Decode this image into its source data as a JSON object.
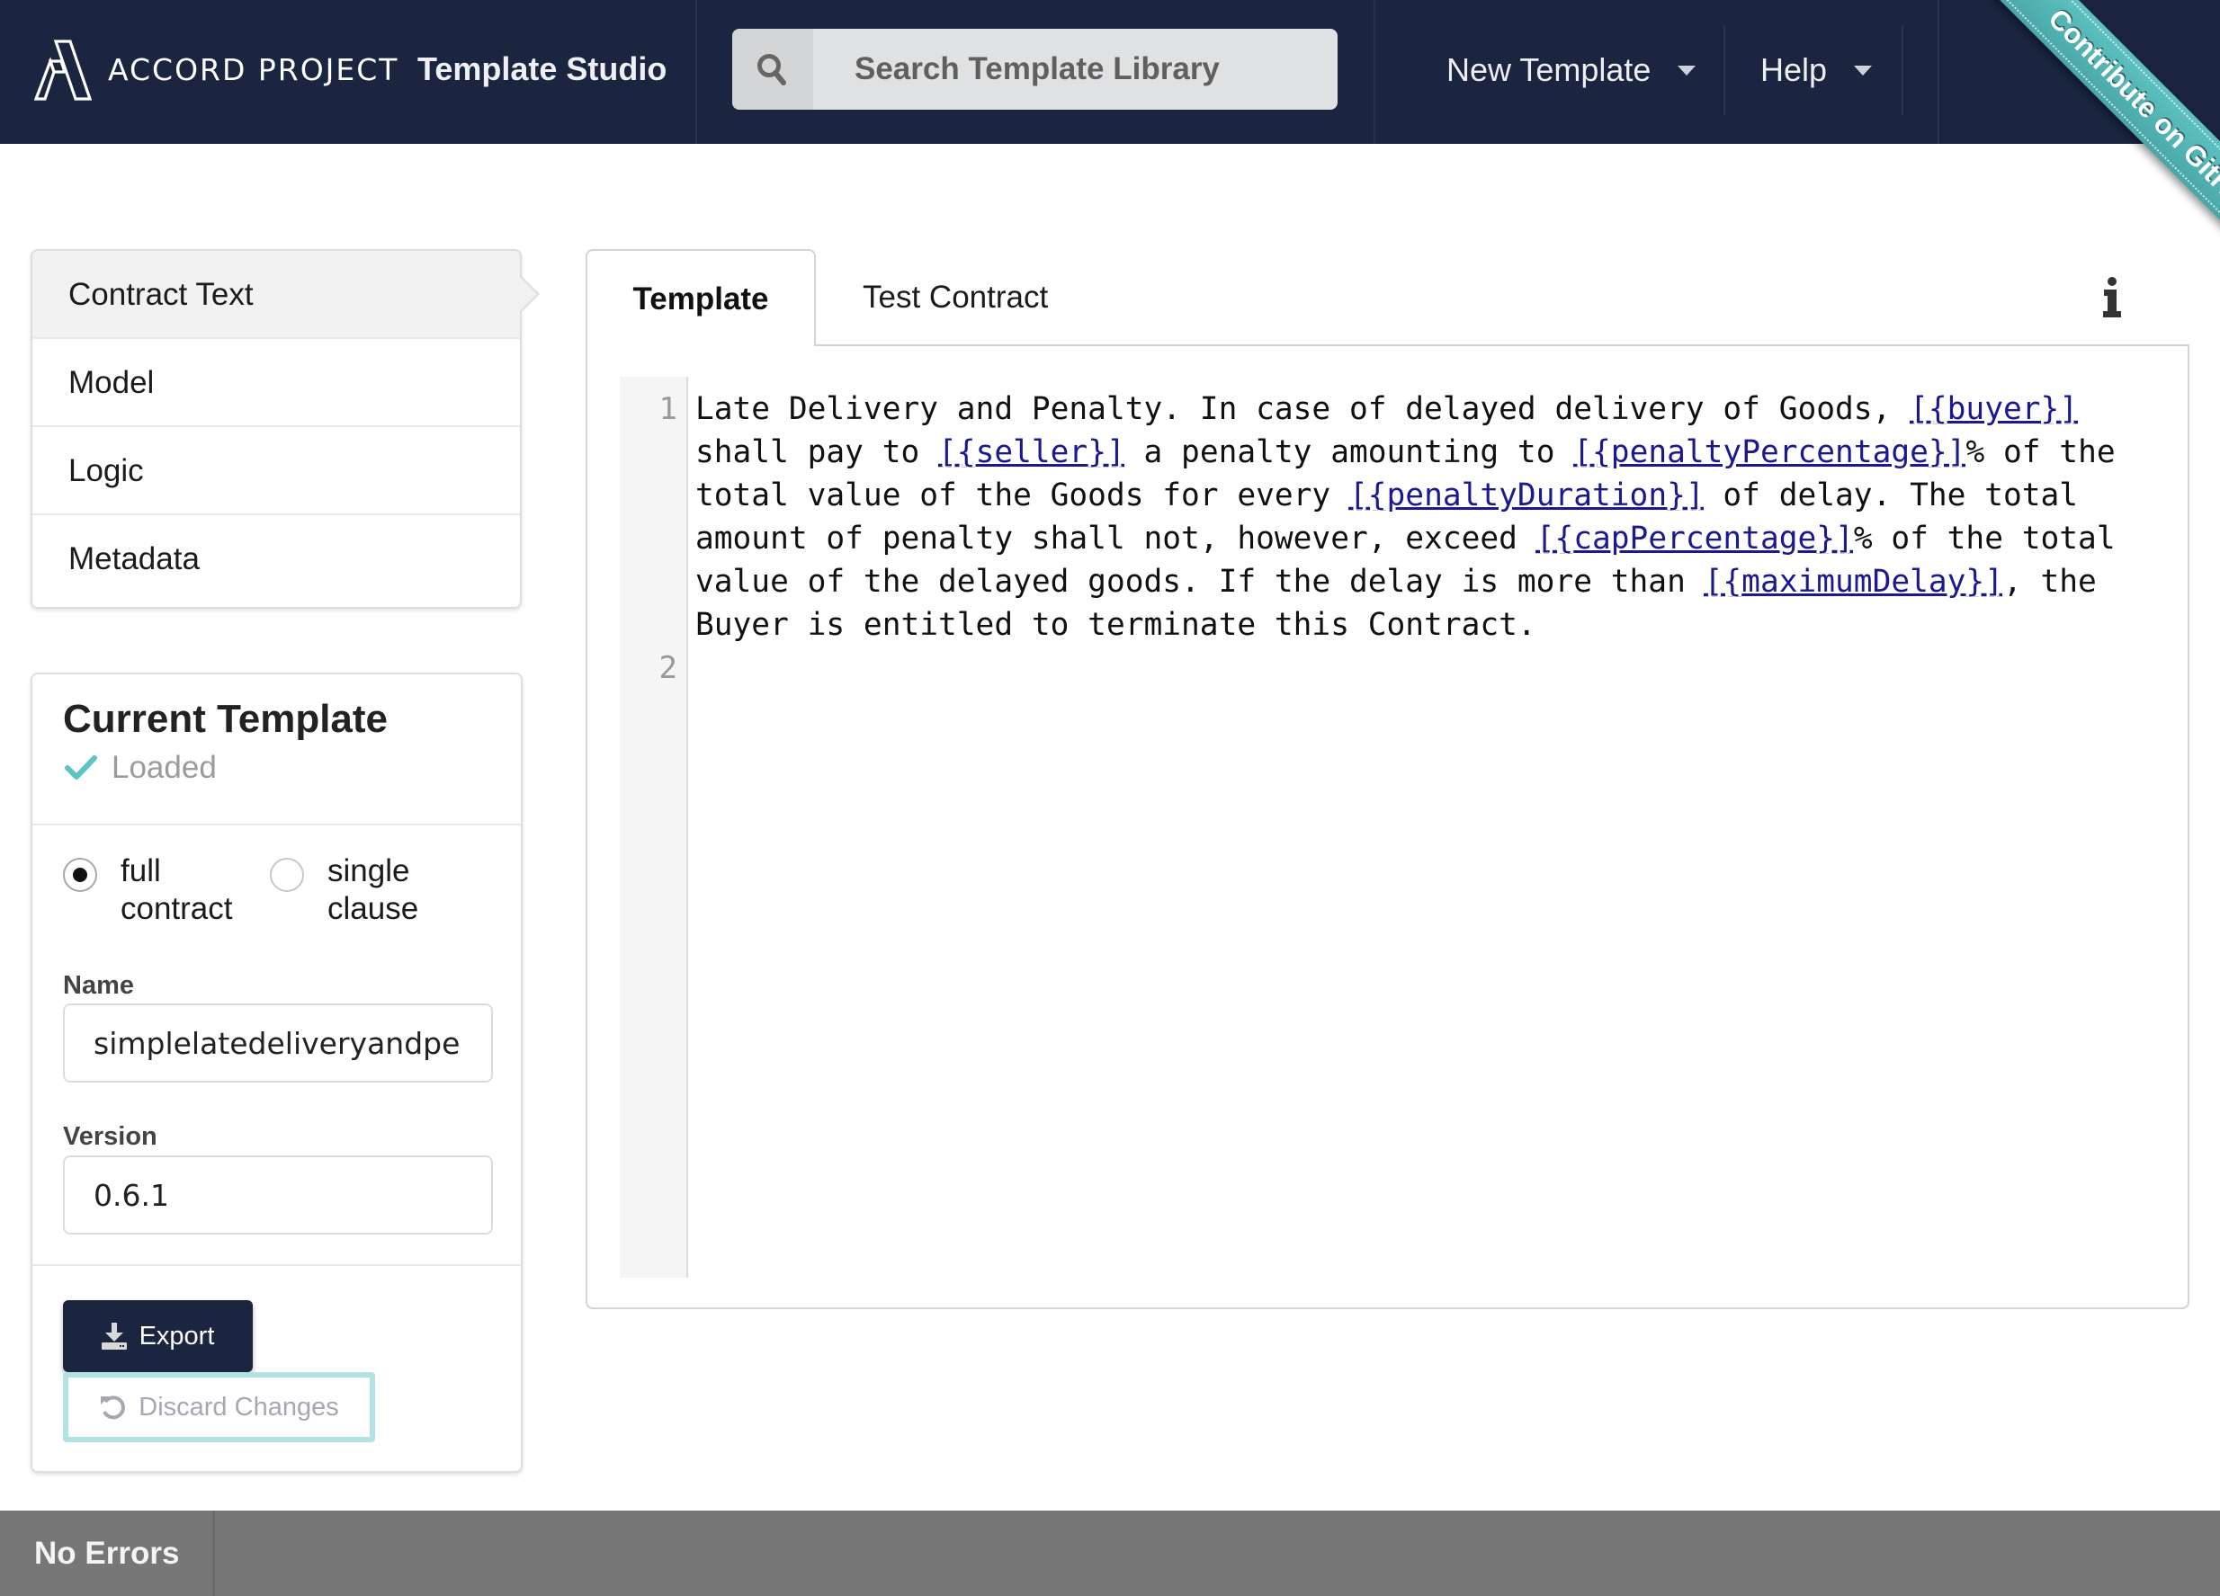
{
  "header": {
    "brand": "ACCORD PROJECT",
    "app_title": "Template Studio",
    "search": {
      "placeholder": "Search Template Library",
      "value": "",
      "icon": "search-icon"
    },
    "menus": [
      {
        "label": "New Template",
        "icon": "caret-down-icon"
      },
      {
        "label": "Help",
        "icon": "caret-down-icon"
      }
    ],
    "ribbon": "Contribute on GitHub",
    "colors": {
      "header_bg": "#1b2540",
      "ribbon": "#5ec2c2"
    }
  },
  "sidebar": {
    "nav": [
      {
        "label": "Contract Text",
        "active": true
      },
      {
        "label": "Model",
        "active": false
      },
      {
        "label": "Logic",
        "active": false
      },
      {
        "label": "Metadata",
        "active": false
      }
    ],
    "current_template": {
      "title": "Current Template",
      "status": "Loaded",
      "status_icon": "check-icon",
      "status_color": "#5bc4c4",
      "mode_options": [
        {
          "label": "full contract",
          "checked": true
        },
        {
          "label": "single clause",
          "checked": false
        }
      ],
      "name_label": "Name",
      "name_value": "simplelatedeliveryandpenalty",
      "version_label": "Version",
      "version_value": "0.6.1",
      "export_label": "Export",
      "discard_label": "Discard Changes"
    }
  },
  "editor": {
    "tabs": [
      {
        "label": "Template",
        "active": true
      },
      {
        "label": "Test Contract",
        "active": false
      }
    ],
    "info_icon": "info-icon",
    "line_numbers": [
      "1",
      "2"
    ],
    "segments": [
      {
        "t": "Late Delivery and Penalty. In case of delayed delivery of Goods, "
      },
      {
        "v": "buyer"
      },
      {
        "t": " shall pay to "
      },
      {
        "v": "seller"
      },
      {
        "t": " a penalty amounting to "
      },
      {
        "v": "penaltyPercentage"
      },
      {
        "t": "% of the total value of the Goods for every "
      },
      {
        "v": "penaltyDuration"
      },
      {
        "t": " of delay. The total amount of penalty shall not, however, exceed "
      },
      {
        "v": "capPercentage"
      },
      {
        "t": "% of the total value of the delayed goods. If the delay is more than "
      },
      {
        "v": "maximumDelay"
      },
      {
        "t": ", the Buyer is entitled to terminate this Contract."
      }
    ],
    "var_open": "[{",
    "var_close": "}]",
    "var_color": "#1a1a8e"
  },
  "status_bar": {
    "text": "No Errors"
  }
}
